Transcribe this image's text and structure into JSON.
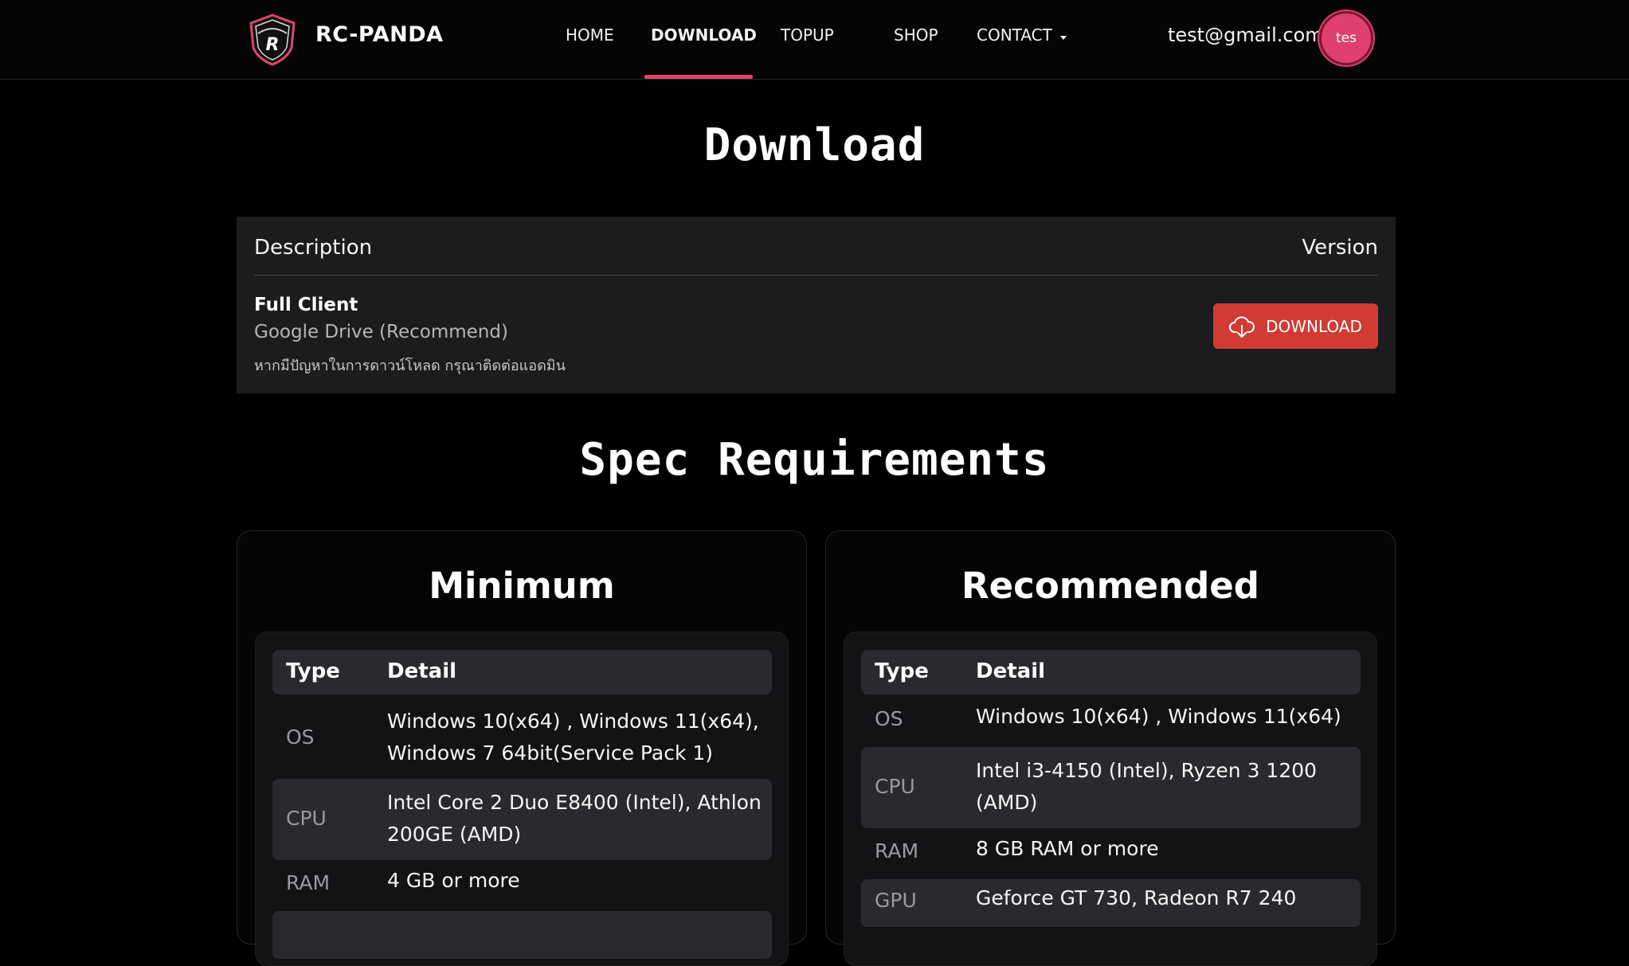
{
  "nav": {
    "brand": "RC-PANDA",
    "logo_text": "R",
    "items": [
      {
        "label": "HOME"
      },
      {
        "label": "DOWNLOAD"
      },
      {
        "label": "TOPUP"
      },
      {
        "label": "SHOP"
      },
      {
        "label": "CONTACT"
      }
    ],
    "active": "DOWNLOAD",
    "email": "test@gmail.com",
    "avatar_text": "tes"
  },
  "download": {
    "title": "Download",
    "header_description": "Description",
    "header_version": "Version",
    "item_name": "Full Client",
    "item_source": "Google Drive (Recommend)",
    "item_note": "หากมีปัญหาในการดาวน์โหลด กรุณาติดต่อแอดมิน",
    "button_label": "DOWNLOAD",
    "button_icon": "cloud-download-icon"
  },
  "spec": {
    "title": "Spec Requirements",
    "minimum": {
      "title": "Minimum",
      "col_type": "Type",
      "col_detail": "Detail",
      "rows": [
        {
          "type": "OS",
          "detail": "Windows 10(x64) , Windows 11(x64), Windows 7 64bit(Service Pack 1)"
        },
        {
          "type": "CPU",
          "detail": "Intel Core 2 Duo E8400 (Intel), Athlon 200GE (AMD)"
        },
        {
          "type": "RAM",
          "detail": "4 GB or more"
        }
      ]
    },
    "recommended": {
      "title": "Recommended",
      "col_type": "Type",
      "col_detail": "Detail",
      "rows": [
        {
          "type": "OS",
          "detail": "Windows 10(x64) , Windows 11(x64)"
        },
        {
          "type": "CPU",
          "detail": "Intel i3-4150 (Intel), Ryzen 3 1200 (AMD)"
        },
        {
          "type": "RAM",
          "detail": "8 GB RAM or more"
        },
        {
          "type": "GPU",
          "detail": "Geforce GT 730, Radeon R7 240"
        }
      ]
    }
  },
  "colors": {
    "accent": "#e0446c",
    "download_button": "#d23a34",
    "panel": "#1c1c1e"
  }
}
